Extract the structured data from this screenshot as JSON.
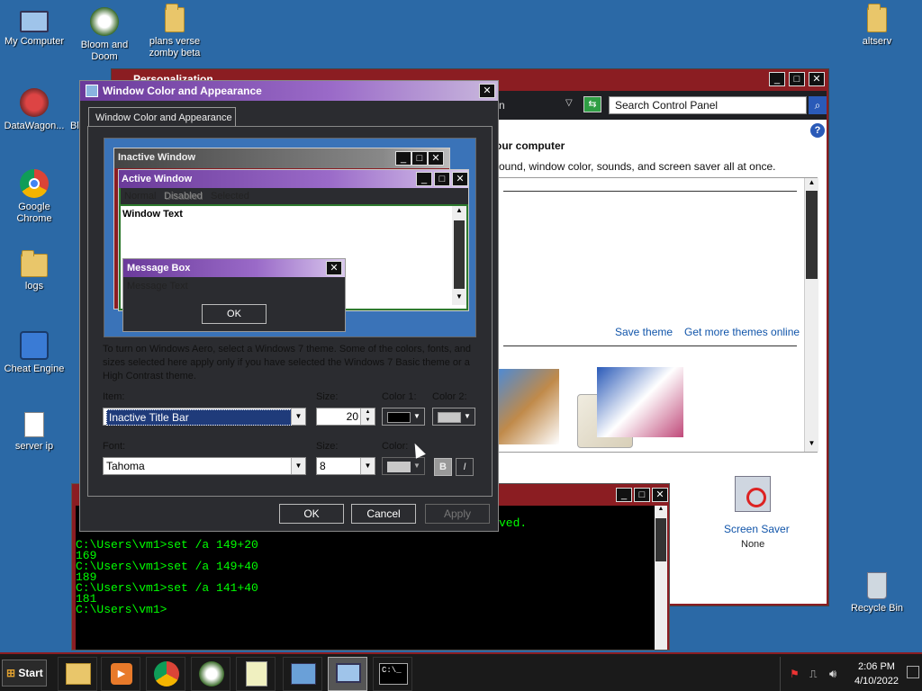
{
  "desktop": {
    "icons": [
      {
        "label": "My Computer",
        "icon": "computer-icon"
      },
      {
        "label": "Bloom and\nDoom",
        "icon": "game-shortcut-icon"
      },
      {
        "label": "plans verse\nzomby beta",
        "icon": "folder-icon"
      },
      {
        "label": "altserv",
        "icon": "folder-icon"
      },
      {
        "label": "DataWagon...",
        "icon": "datawagon-icon"
      },
      {
        "label": "Google Chrome",
        "icon": "chrome-icon"
      },
      {
        "label": "logs",
        "icon": "folder-icon"
      },
      {
        "label": "Cheat Engine",
        "icon": "cheat-engine-icon"
      },
      {
        "label": "server ip",
        "icon": "text-file-icon"
      },
      {
        "label": "Recycle Bin",
        "icon": "recycle-bin-icon"
      }
    ],
    "partial_label": "Bl"
  },
  "personalization": {
    "title": "Personalization",
    "address_tail": "n",
    "search_placeholder": "Search Control Panel",
    "heading_partial": "our computer",
    "desc_partial": "round, window color, sounds, and screen saver all at once.",
    "save_theme": "Save theme",
    "get_more_themes": "Get more themes online",
    "screen_saver_label": "Screen Saver",
    "screen_saver_value": "None"
  },
  "dialog": {
    "title": "Window Color and Appearance",
    "tab": "Window Color and Appearance",
    "preview": {
      "inactive_title": "Inactive Window",
      "active_title": "Active Window",
      "menu_normal": "Normal",
      "menu_disabled": "Disabled",
      "menu_selected": "Selected",
      "window_text": "Window Text",
      "msgbox_title": "Message Box",
      "msgbox_text": "Message Text",
      "msgbox_ok": "OK"
    },
    "info_text": "To turn on Windows Aero, select a Windows 7 theme.  Some of the colors, fonts, and sizes selected here apply only if you have selected the Windows 7 Basic theme or a High Contrast theme.",
    "item_label": "Item:",
    "item_value": "Inactive Title Bar",
    "size_label": "Size:",
    "size_value": "20",
    "color1_label": "Color 1:",
    "color2_label": "Color 2:",
    "font_label": "Font:",
    "font_value": "Tahoma",
    "font_size_label": "Size:",
    "font_size_value": "8",
    "font_color_label": "Color:",
    "bold_label": "B",
    "italic_label": "I",
    "ok": "OK",
    "cancel": "Cancel",
    "apply": "Apply"
  },
  "cmd": {
    "partial_text": "ved.",
    "lines": [
      "C:\\Users\\vm1>set /a 149+20",
      "169",
      "C:\\Users\\vm1>set /a 149+40",
      "189",
      "C:\\Users\\vm1>set /a 141+40",
      "181",
      "C:\\Users\\vm1>"
    ]
  },
  "taskbar": {
    "start": "Start",
    "time": "2:06 PM",
    "date": "4/10/2022"
  },
  "colors": {
    "title_purple": "#6a3a9a",
    "desktop": "#2b69a6",
    "cmd_green": "#00ff00"
  }
}
